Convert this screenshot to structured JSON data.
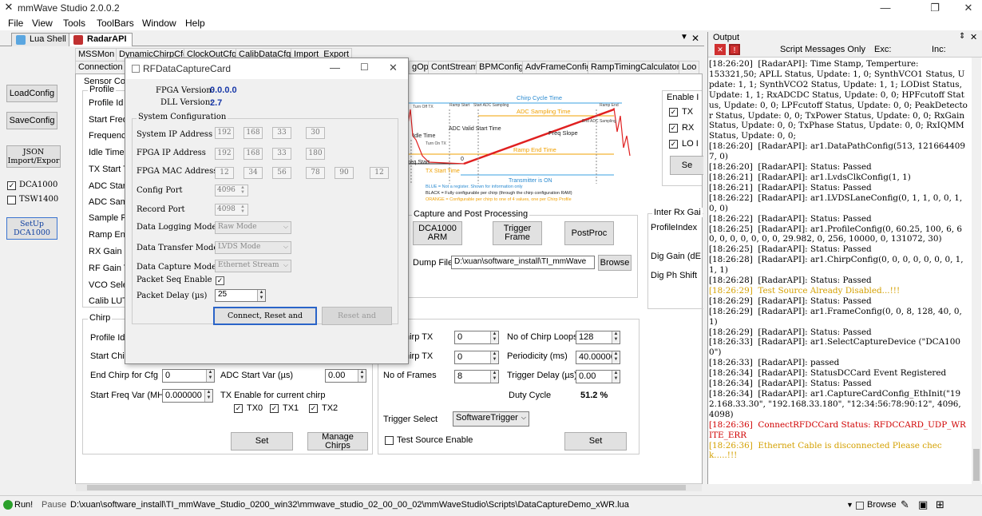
{
  "window": {
    "title": "mmWave Studio 2.0.0.2"
  },
  "menu": [
    "File",
    "View",
    "Tools",
    "ToolBars",
    "Window",
    "Help"
  ],
  "doc_tabs": [
    {
      "label": "Lua Shell"
    },
    {
      "label": "RadarAPI"
    }
  ],
  "left_buttons": {
    "load_config": "LoadConfig",
    "save_config": "SaveConfig",
    "json": "JSON Import/Expor",
    "dca1000": "DCA1000",
    "tsw1400": "TSW1400",
    "setup": "SetUp DCA1000"
  },
  "main_tabs_row1": [
    "MSSMon",
    "DynamicChirpCfg",
    "ClockOutCfg",
    "CalibDataCfg",
    "Import_Export"
  ],
  "main_tabs_row2": [
    "Connection",
    "gOp",
    "ContStream",
    "BPMConfig",
    "AdvFrameConfig",
    "RampTimingCalculator",
    "Loo"
  ],
  "sensor": {
    "group_title": "Sensor Con",
    "profile_title": "Profile",
    "labels": [
      "Profile Id",
      "Start Freq (",
      "Frequency",
      "Idle Time (",
      "TX Start Tir",
      "ADC Start T",
      "ADC Samp",
      "Sample Ra",
      "Ramp End",
      "RX Gain (d",
      "RF Gain Ta",
      "VCO Select",
      "Calib LUT"
    ]
  },
  "diagram": {
    "chirp_cycle": "Chirp Cycle Time",
    "adc_sampling": "ADC Sampling Time",
    "freq_slope": "Freq Slope",
    "adc_valid": "ADC Valid Start Time",
    "idle_time": "Idle Time",
    "ramp_end": "Ramp End Time",
    "tx_start": "TX Start Time",
    "tx_on": "Transmitter is ON",
    "freq_start": "Freq Start",
    "zero": "0",
    "turn_off_tx": "Turn Off TX",
    "turn_on_tx": "Turn On TX",
    "ramp_start": "Ramp Start",
    "start_adc": "Start ADC Sampling",
    "end_adc": "End ADC Sampling",
    "ramp_end_small": "Ramp End",
    "legend_blue": "BLUE = Not a register. Shown for information only",
    "legend_black": "BLACK = Fully configurable per chirp (through the chirp configuration RAM)",
    "legend_orange": "ORANGE = Configurable per chirp to one of 4 values, one per Chirp Profile"
  },
  "enable_panel": {
    "title": "Enable I",
    "tx": "TX",
    "rx": "RX",
    "lo": "LO I",
    "set": "Se"
  },
  "capture": {
    "title": "Capture and Post Processing",
    "dca_arm": "DCA1000 ARM",
    "trigger": "Trigger Frame",
    "postproc": "PostProc",
    "dump_label": "Dump File:",
    "dump_value": "D:\\xuan\\software_install\\TI_mmWave",
    "browse": "Browse"
  },
  "interrx": {
    "title": "Inter Rx Gai",
    "profile_index": "ProfileIndex",
    "dig_gain": "Dig Gain (dE",
    "dig_phase": "Dig Ph Shift"
  },
  "chirp": {
    "title": "Chirp",
    "profile_id": "Profile Id",
    "start_chirp": "Start Chirp",
    "end_chirp": "End Chirp for Cfg",
    "end_chirp_val": "0",
    "adc_start_var": "ADC Start Var (µs)",
    "adc_start_val": "0.00",
    "start_freq_var": "Start Freq Var (MHz)",
    "start_freq_val": "0.000000",
    "tx_enable": "TX Enable for current chirp",
    "tx0": "TX0",
    "tx1": "TX1",
    "tx2": "TX2",
    "set": "Set",
    "manage": "Manage Chirps"
  },
  "frame": {
    "chirp_tx1": "hirp TX",
    "chirp_tx1_val": "0",
    "chirp_tx2": "hirp TX",
    "chirp_tx2_val": "0",
    "no_frames": "No of Frames",
    "no_frames_val": "8",
    "loops": "No of Chirp Loops",
    "loops_val": "128",
    "periodicity": "Periodicity (ms)",
    "periodicity_val": "40.000000",
    "trig_delay": "Trigger Delay (µs)",
    "trig_delay_val": "0.00",
    "duty_cycle": "Duty Cycle",
    "duty_val": "51.2 %",
    "trigger_select": "Trigger Select",
    "trigger_val": "SoftwareTrigger",
    "test_source": "Test Source Enable",
    "set": "Set"
  },
  "dialog": {
    "title": "RFDataCaptureCard",
    "fpga_version_label": "FPGA Version:",
    "fpga_version": "0.0.0.0",
    "dll_version_label": "DLL Version:",
    "dll_version": "2.7",
    "sys_config": "System Configuration",
    "sys_ip_label": "System IP Address",
    "sys_ip": [
      "192",
      "168",
      "33",
      "30"
    ],
    "fpga_ip_label": "FPGA IP Address",
    "fpga_ip": [
      "192",
      "168",
      "33",
      "180"
    ],
    "mac_label": "FPGA MAC Address",
    "mac": [
      "12",
      "34",
      "56",
      "78",
      "90",
      "12"
    ],
    "config_port_label": "Config Port",
    "config_port": "4096",
    "record_port_label": "Record Port",
    "record_port": "4098",
    "logging_label": "Data Logging Mode",
    "logging_val": "Raw Mode",
    "transfer_label": "Data Transfer Mode",
    "transfer_val": "LVDS Mode",
    "capture_label": "Data Capture Mode",
    "capture_val": "Ethernet Stream",
    "seq_label": "Packet Seq Enable",
    "delay_label": "Packet Delay (µs)",
    "delay_val": "25",
    "connect_btn": "Connect, Reset and",
    "reset_btn": "Reset and"
  },
  "output": {
    "title": "Output",
    "filter": "Script Messages Only",
    "exc": "Exc:",
    "inc": "Inc:",
    "lines": [
      {
        "t": "[18:26:20]  [RadarAPI]: Time Stamp, Temperture:",
        "c": "#000"
      },
      {
        "t": "153321,50; APLL Status, Update: 1, 0; SynthVCO1 Status, Update: 1, 1; SynthVCO2 Status, Update: 1, 1; LODist Status, Update: 1, 1; RxADCDC Status, Update: 0, 0; HPFcutoff Status, Update: 0, 0; LPFcutoff Status, Update: 0, 0; PeakDetector Status, Update: 0, 0; TxPower Status, Update: 0, 0; RxGain Status, Update: 0, 0; TxPhase Status, Update: 0, 0; RxIQMM Status, Update: 0, 0;",
        "c": "#000"
      },
      {
        "t": "[18:26:20]  [RadarAPI]: ar1.DataPathConfig(513, 1216644097, 0)",
        "c": "#000"
      },
      {
        "t": "[18:26:20]  [RadarAPI]: Status: Passed",
        "c": "#000"
      },
      {
        "t": "[18:26:21]  [RadarAPI]: ar1.LvdsClkConfig(1, 1)",
        "c": "#000"
      },
      {
        "t": "[18:26:21]  [RadarAPI]: Status: Passed",
        "c": "#000"
      },
      {
        "t": "[18:26:22]  [RadarAPI]: ar1.LVDSLaneConfig(0, 1, 1, 0, 0, 1, 0, 0)",
        "c": "#000"
      },
      {
        "t": "[18:26:22]  [RadarAPI]: Status: Passed",
        "c": "#000"
      },
      {
        "t": "[18:26:25]  [RadarAPI]: ar1.ProfileConfig(0, 60.25, 100, 6, 60, 0, 0, 0, 0, 0, 0, 29.982, 0, 256, 10000, 0, 131072, 30)",
        "c": "#000"
      },
      {
        "t": "[18:26:25]  [RadarAPI]: Status: Passed",
        "c": "#000"
      },
      {
        "t": "[18:26:28]  [RadarAPI]: ar1.ChirpConfig(0, 0, 0, 0, 0, 0, 0, 1, 1, 1)",
        "c": "#000"
      },
      {
        "t": "[18:26:28]  [RadarAPI]: Status: Passed",
        "c": "#000"
      },
      {
        "t": "[18:26:29]  Test Source Already Disabled...!!!",
        "c": "#d4a000"
      },
      {
        "t": "[18:26:29]  [RadarAPI]: Status: Passed",
        "c": "#000"
      },
      {
        "t": "[18:26:29]  [RadarAPI]: ar1.FrameConfig(0, 0, 8, 128, 40, 0, 1)",
        "c": "#000"
      },
      {
        "t": "[18:26:29]  [RadarAPI]: Status: Passed",
        "c": "#000"
      },
      {
        "t": "[18:26:33]  [RadarAPI]: ar1.SelectCaptureDevice (\"DCA1000\")",
        "c": "#000"
      },
      {
        "t": "[18:26:33]  [RadarAPI]: passed",
        "c": "#000"
      },
      {
        "t": "[18:26:34]  [RadarAPI]: StatusDCCard Event Registered",
        "c": "#000"
      },
      {
        "t": "[18:26:34]  [RadarAPI]: Status: Passed",
        "c": "#000"
      },
      {
        "t": "[18:26:34]  [RadarAPI]: ar1.CaptureCardConfig_EthInit(\"192.168.33.30\", \"192.168.33.180\", \"12:34:56:78:90:12\", 4096, 4098)",
        "c": "#000"
      },
      {
        "t": "[18:26:36]  ConnectRFDCCard Status: RFDCCARD_UDP_WRITE_ERR",
        "c": "#d00000"
      },
      {
        "t": "[18:26:36]  Ethernet Cable is disconnected Please check.....!!!",
        "c": "#d4a000"
      }
    ]
  },
  "status": {
    "run": "Run!",
    "pause": "Pause",
    "path": "D:\\xuan\\software_install\\TI_mmWave_Studio_0200_win32\\mmwave_studio_02_00_00_02\\mmWaveStudio\\Scripts\\DataCaptureDemo_xWR.lua",
    "browse": "Browse"
  }
}
